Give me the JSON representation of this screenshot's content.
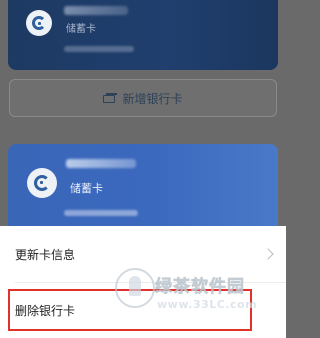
{
  "cards": [
    {
      "type_label": "储蓄卡"
    },
    {
      "type_label": "储蓄卡"
    }
  ],
  "add_card": {
    "label": "新增银行卡"
  },
  "sheet": {
    "items": [
      {
        "label": "更新卡信息"
      },
      {
        "label": "删除银行卡"
      }
    ]
  },
  "watermark": {
    "text": "绿茶软件园",
    "url": "www.33LC.com"
  },
  "colors": {
    "highlight": "#e0312b",
    "card_blue": "#3b69be",
    "card_dark": "#203f6e"
  }
}
